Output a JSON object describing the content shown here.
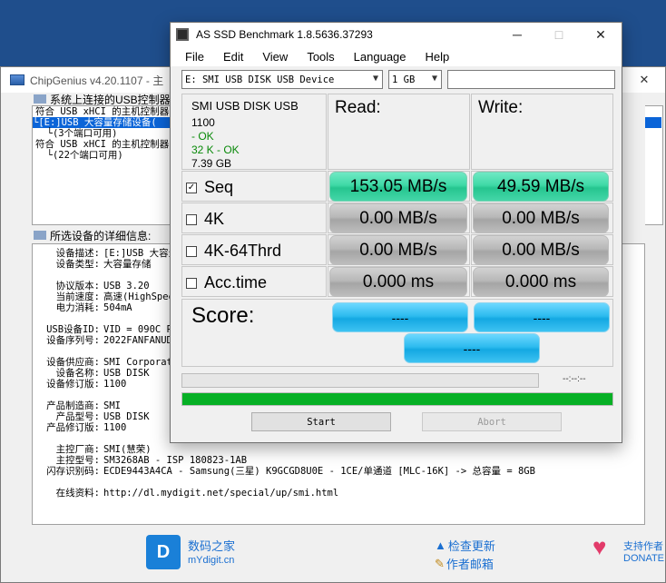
{
  "chipgenius": {
    "title": "ChipGenius v4.20.1107 - 主",
    "window_controls": [
      "─",
      "□",
      "✕"
    ],
    "tree_header": "系统上连接的USB控制器",
    "tree": [
      "符合 USB xHCI 的主机控制器",
      "└[E:]USB 大容量存储设备(",
      "  └(3个端口可用)",
      "符合 USB xHCI 的主机控制器",
      "  └(22个端口可用)"
    ],
    "detail_header": "所选设备的详细信息:",
    "details": [
      {
        "k": "设备描述:",
        "v": "[E:]USB 大容量"
      },
      {
        "k": "设备类型:",
        "v": "大容量存储"
      },
      {
        "k": "协议版本:",
        "v": "USB 3.20"
      },
      {
        "k": "当前速度:",
        "v": "高速(HighSpee"
      },
      {
        "k": "电力消耗:",
        "v": "504mA"
      },
      {
        "k": "USB设备ID:",
        "v": "VID = 090C PI"
      },
      {
        "k": "设备序列号:",
        "v": "2022FANFANUDI"
      },
      {
        "k": "设备供应商:",
        "v": "SMI Corporati"
      },
      {
        "k": "设备名称:",
        "v": "USB DISK"
      },
      {
        "k": "设备修订版:",
        "v": "1100"
      },
      {
        "k": "产品制造商:",
        "v": "SMI"
      },
      {
        "k": "产品型号:",
        "v": "USB DISK"
      },
      {
        "k": "产品修订版:",
        "v": "1100"
      },
      {
        "k": "主控厂商:",
        "v": "SMI(慧荣)"
      },
      {
        "k": "主控型号:",
        "v": "SM3268AB - ISP 180823-1AB"
      },
      {
        "k": "闪存识别码:",
        "v": "ECDE9443A4CA - Samsung(三星) K9GCGD8U0E - 1CE/单通道 [MLC-16K] -> 总容量 = 8GB"
      },
      {
        "k": "在线资料:",
        "v": "http://dl.mydigit.net/special/up/smi.html"
      }
    ],
    "footer": {
      "logo_letter": "D",
      "brand_cn": "数码之家",
      "brand_en": "mYdigit.cn",
      "check_update": "检查更新",
      "email_author": "作者邮箱",
      "support_author": "支持作者",
      "donate": "DONATE"
    }
  },
  "as_ssd": {
    "title": "AS SSD Benchmark 1.8.5636.37293",
    "window_controls": [
      "─",
      "□",
      "✕"
    ],
    "menu": [
      "File",
      "Edit",
      "View",
      "Tools",
      "Language",
      "Help"
    ],
    "drive_select": "E: SMI USB DISK USB Device",
    "size_select": "1 GB",
    "info": {
      "name": "SMI USB DISK USB",
      "fw": "1100",
      "status1": " - OK",
      "status2": "32 K - OK",
      "capacity": "7.39 GB"
    },
    "read_label": "Read:",
    "write_label": "Write:",
    "rows": [
      {
        "label": "Seq",
        "checked": true,
        "read": "153.05 MB/s",
        "write": "49.59 MB/s",
        "style": "green"
      },
      {
        "label": "4K",
        "checked": false,
        "read": "0.00 MB/s",
        "write": "0.00 MB/s",
        "style": "gray"
      },
      {
        "label": "4K-64Thrd",
        "checked": false,
        "read": "0.00 MB/s",
        "write": "0.00 MB/s",
        "style": "gray"
      },
      {
        "label": "Acc.time",
        "checked": false,
        "read": "0.000 ms",
        "write": "0.000 ms",
        "style": "gray"
      }
    ],
    "score_label": "Score:",
    "score_read": "----",
    "score_write": "----",
    "score_total": "----",
    "progress_time": "--:--:--",
    "progress_fraction": 1.0,
    "start_label": "Start",
    "abort_label": "Abort",
    "colors": {
      "green": "#3fd9a6",
      "cyan": "#2dbbef",
      "progress": "#06b025"
    }
  }
}
